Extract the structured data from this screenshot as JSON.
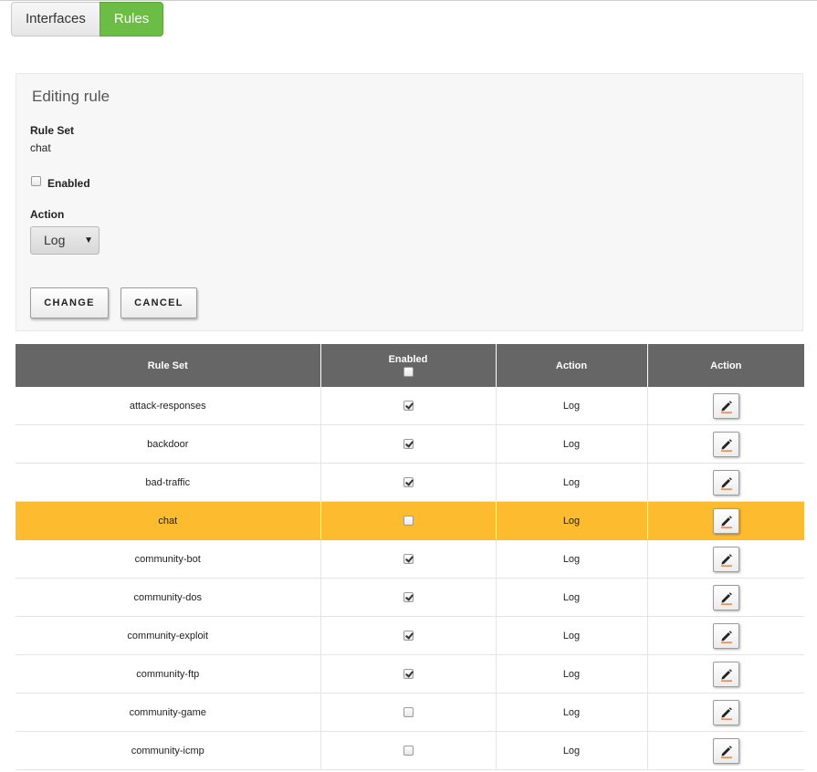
{
  "tabs": [
    {
      "label": "Interfaces",
      "active": false
    },
    {
      "label": "Rules",
      "active": true
    }
  ],
  "edit_panel": {
    "title": "Editing rule",
    "rule_set_label": "Rule Set",
    "rule_set_value": "chat",
    "enabled_label": "Enabled",
    "enabled_checked": false,
    "action_label": "Action",
    "action_selected": "Log",
    "change_label": "CHANGE",
    "cancel_label": "CANCEL"
  },
  "table": {
    "headers": {
      "rule_set": "Rule Set",
      "enabled": "Enabled",
      "action": "Action",
      "action2": "Action"
    },
    "rows": [
      {
        "name": "attack-responses",
        "enabled": true,
        "action": "Log"
      },
      {
        "name": "backdoor",
        "enabled": true,
        "action": "Log"
      },
      {
        "name": "bad-traffic",
        "enabled": true,
        "action": "Log"
      },
      {
        "name": "chat",
        "enabled": false,
        "action": "Log",
        "highlighted": true
      },
      {
        "name": "community-bot",
        "enabled": true,
        "action": "Log"
      },
      {
        "name": "community-dos",
        "enabled": true,
        "action": "Log"
      },
      {
        "name": "community-exploit",
        "enabled": true,
        "action": "Log"
      },
      {
        "name": "community-ftp",
        "enabled": true,
        "action": "Log"
      },
      {
        "name": "community-game",
        "enabled": false,
        "action": "Log"
      },
      {
        "name": "community-icmp",
        "enabled": false,
        "action": "Log"
      }
    ]
  },
  "icons": {
    "edit": "pencil-icon",
    "select": "caret-down-icon"
  },
  "colors": {
    "active_tab": "#6bbd45",
    "header_bg": "#666666",
    "highlight_row": "#fdbb30",
    "pencil_underline": "#e8661a"
  }
}
